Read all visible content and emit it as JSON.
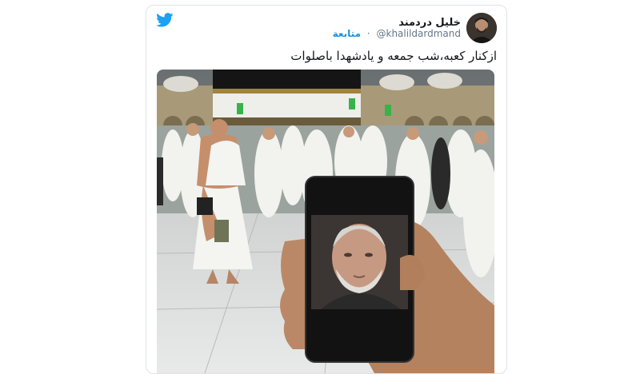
{
  "tweet": {
    "display_name": "خلیل دردمند",
    "handle": "@khalildardmand",
    "separator": "·",
    "follow_label": "متابعة",
    "text": "ازکنار کعبه،شب جمعه و یادشهدا باصلوات"
  },
  "icons": {
    "platform": "twitter-bird-icon"
  },
  "colors": {
    "accent": "#1b95e0",
    "twitter_blue": "#1da1f2"
  }
}
